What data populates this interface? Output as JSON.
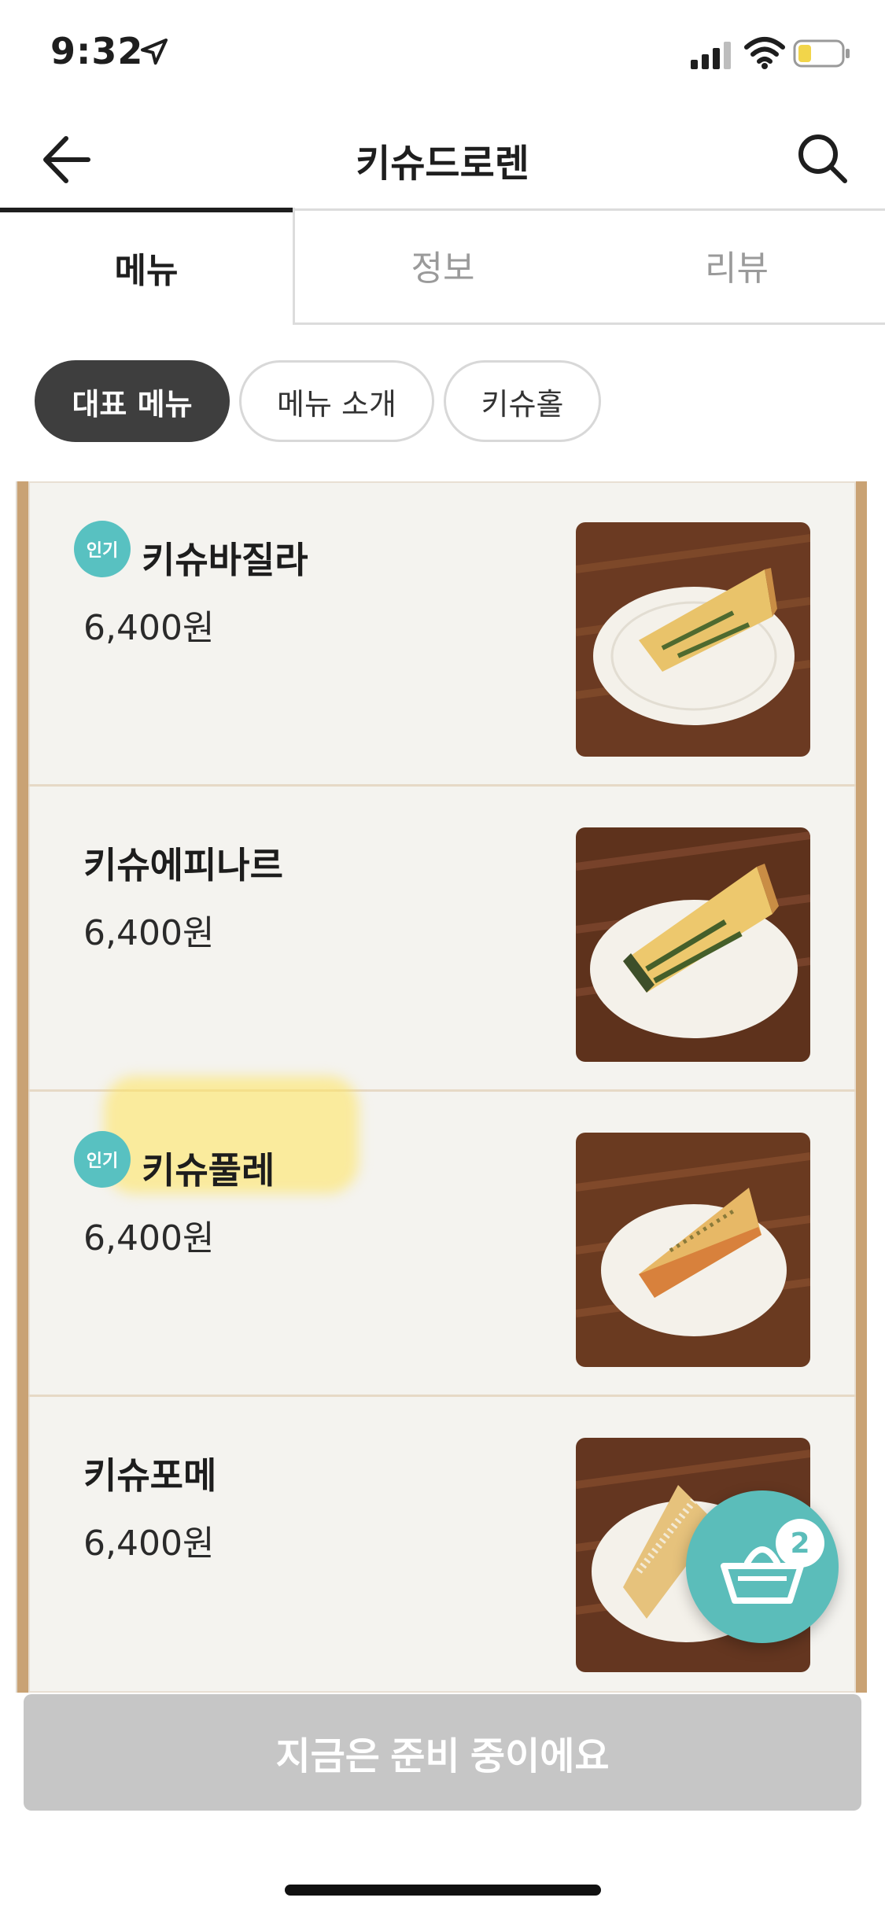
{
  "status_bar": {
    "time": "9:32"
  },
  "header": {
    "title": "키슈드로렌"
  },
  "tabs": [
    {
      "label": "메뉴",
      "active": true
    },
    {
      "label": "정보",
      "active": false
    },
    {
      "label": "리뷰",
      "active": false
    }
  ],
  "chips": [
    {
      "label": "대표 메뉴",
      "active": true
    },
    {
      "label": "메뉴 소개",
      "active": false
    },
    {
      "label": "키슈홀",
      "active": false
    }
  ],
  "menu_items": [
    {
      "name": "키슈바질라",
      "price": "6,400원",
      "badge": "인기"
    },
    {
      "name": "키슈에피나르",
      "price": "6,400원",
      "badge": ""
    },
    {
      "name": "키슈풀레",
      "price": "6,400원",
      "badge": "인기",
      "highlighted": true
    },
    {
      "name": "키슈포메",
      "price": "6,400원",
      "badge": ""
    }
  ],
  "cart": {
    "count": "2"
  },
  "order_button": {
    "label": "지금은 준비 중이에요"
  },
  "colors": {
    "accent": "#5bbdba",
    "board_frame": "#c9a274",
    "disabled": "#c6c6c6"
  }
}
